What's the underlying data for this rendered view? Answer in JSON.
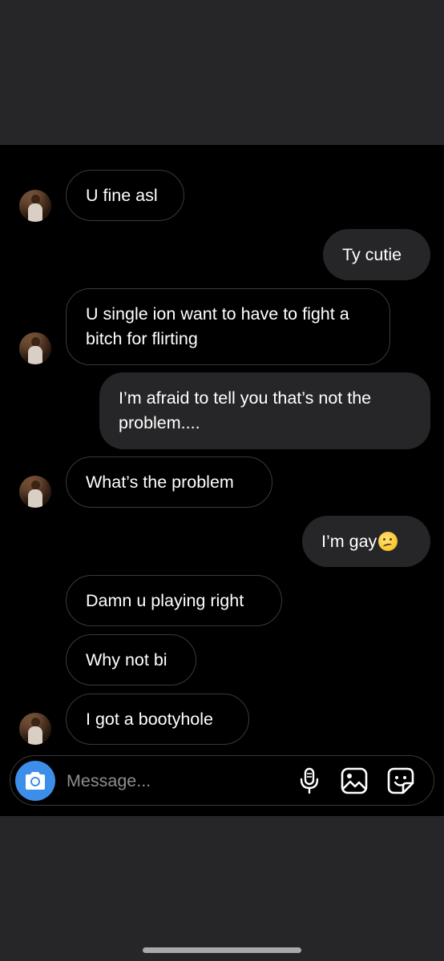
{
  "conversation": {
    "messages": [
      {
        "direction": "incoming",
        "text": "U fine asl",
        "has_avatar": true
      },
      {
        "direction": "outgoing",
        "text": "Ty cutie"
      },
      {
        "direction": "incoming",
        "text": "U single ion want to have to fight a bitch for flirting",
        "has_avatar": true
      },
      {
        "direction": "outgoing",
        "text": "I’m afraid to tell you that’s not the problem...."
      },
      {
        "direction": "incoming",
        "text": "What’s the problem",
        "has_avatar": true
      },
      {
        "direction": "outgoing",
        "text": "I’m gay",
        "emoji": "woozy-face"
      },
      {
        "direction": "incoming",
        "text": "Damn u playing right"
      },
      {
        "direction": "incoming",
        "text": "Why not bi"
      },
      {
        "direction": "incoming",
        "text": "I got a bootyhole",
        "has_avatar": true
      }
    ]
  },
  "composer": {
    "placeholder": "Message...",
    "value": "",
    "icons": [
      "camera-icon",
      "microphone-icon",
      "gallery-icon",
      "sticker-icon"
    ]
  },
  "colors": {
    "background": "#000000",
    "chrome": "#262628",
    "outgoing_bubble": "#262628",
    "incoming_border": "#3a3a3c",
    "camera_button": "#3d8ee8",
    "placeholder": "#8e8e93"
  }
}
